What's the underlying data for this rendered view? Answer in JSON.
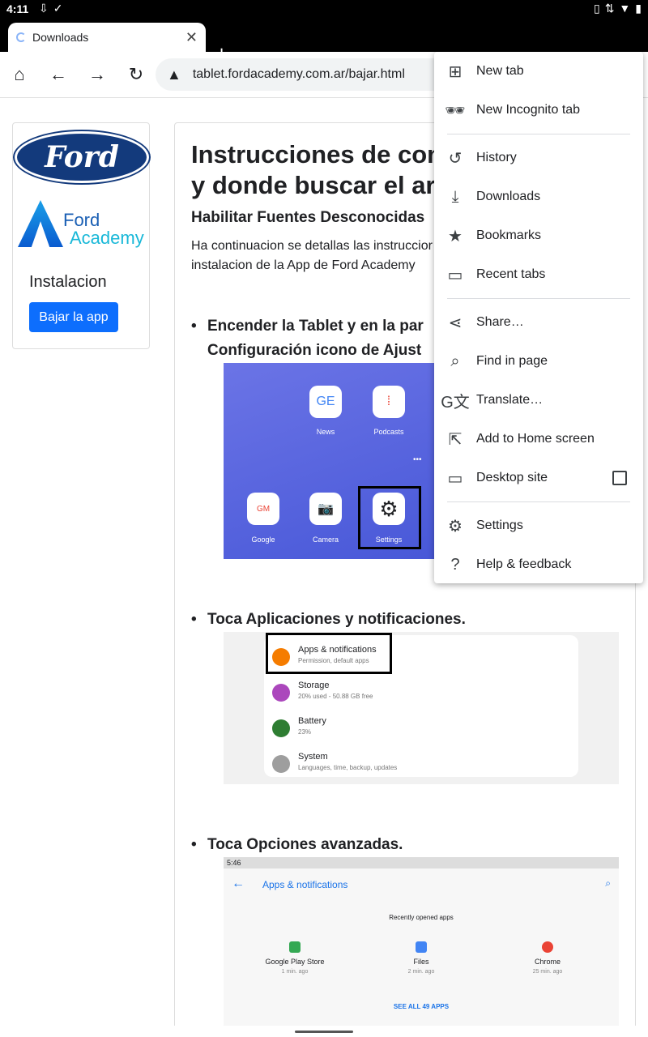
{
  "status_bar": {
    "time": "4:11",
    "left_icons": [
      "download-icon",
      "check-icon"
    ],
    "right_icons": [
      "vibrate-icon",
      "data-icon",
      "wifi-icon",
      "battery-icon"
    ]
  },
  "tab": {
    "title": "Downloads",
    "close": "✕"
  },
  "new_tab": "+",
  "toolbar": {
    "url": "tablet.fordacademy.com.ar/bajar.html"
  },
  "sidebar": {
    "ford_logo": "Ford",
    "academy_line1": "Ford",
    "academy_line2": "Academy",
    "academy_mark": "Ford",
    "heading": "Instalacion",
    "button": "Bajar la app"
  },
  "main": {
    "title_line1": "Instrucciones de com",
    "title_line2": "y donde buscar el arc",
    "subtitle": "Habilitar Fuentes Desconocidas",
    "intro_line1": "Ha continuacion se detallas las instruccior",
    "intro_line2": "instalacion de la App de Ford Academy",
    "step1_line1": "Encender la Tablet y en la par",
    "step1_line2": "Configuración icono de Ajust",
    "step2": "Toca Aplicaciones y notificaciones.",
    "step3": "Toca Opciones avanzadas."
  },
  "shot1": {
    "apps": [
      {
        "label": "News",
        "glyph": "GE"
      },
      {
        "label": "Podcasts",
        "glyph": "⁞"
      },
      {
        "label": "Google",
        "glyph": "GM"
      },
      {
        "label": "Camera",
        "glyph": "📷"
      },
      {
        "label": "Settings",
        "glyph": "⚙"
      }
    ]
  },
  "shot2": {
    "rows": [
      {
        "title": "Apps & notifications",
        "sub": "Permission, default apps",
        "color": "#f57c00"
      },
      {
        "title": "Storage",
        "sub": "20% used - 50.88 GB free",
        "color": "#ab47bc"
      },
      {
        "title": "Battery",
        "sub": "23%",
        "color": "#2e7d32"
      },
      {
        "title": "System",
        "sub": "Languages, time, backup, updates",
        "color": "#9e9e9e"
      }
    ]
  },
  "shot3": {
    "status_time": "5:46",
    "title": "Apps & notifications",
    "recent_label": "Recently opened apps",
    "apps": [
      {
        "name": "Google Play Store",
        "time": "1 min. ago",
        "color": "#34a853"
      },
      {
        "name": "Files",
        "time": "2 min. ago",
        "color": "#4285f4"
      },
      {
        "name": "Chrome",
        "time": "25 min. ago",
        "color": "#ea4335"
      }
    ],
    "see_all": "SEE ALL 49 APPS"
  },
  "menu": {
    "items": [
      {
        "label": "New tab",
        "icon": "new-tab-icon"
      },
      {
        "label": "New Incognito tab",
        "icon": "incognito-icon"
      },
      {
        "label": "History",
        "icon": "history-icon"
      },
      {
        "label": "Downloads",
        "icon": "downloads-icon"
      },
      {
        "label": "Bookmarks",
        "icon": "star-icon"
      },
      {
        "label": "Recent tabs",
        "icon": "devices-icon"
      },
      {
        "label": "Share…",
        "icon": "share-icon"
      },
      {
        "label": "Find in page",
        "icon": "find-icon"
      },
      {
        "label": "Translate…",
        "icon": "translate-icon"
      },
      {
        "label": "Add to Home screen",
        "icon": "add-home-icon"
      },
      {
        "label": "Desktop site",
        "icon": "desktop-icon"
      },
      {
        "label": "Settings",
        "icon": "settings-icon"
      },
      {
        "label": "Help & feedback",
        "icon": "help-icon"
      }
    ],
    "desktop_site_checked": false
  },
  "colors": {
    "ford_blue": "#133a7c",
    "button_blue": "#0d6efd",
    "wallpaper": "#5a66e0"
  }
}
